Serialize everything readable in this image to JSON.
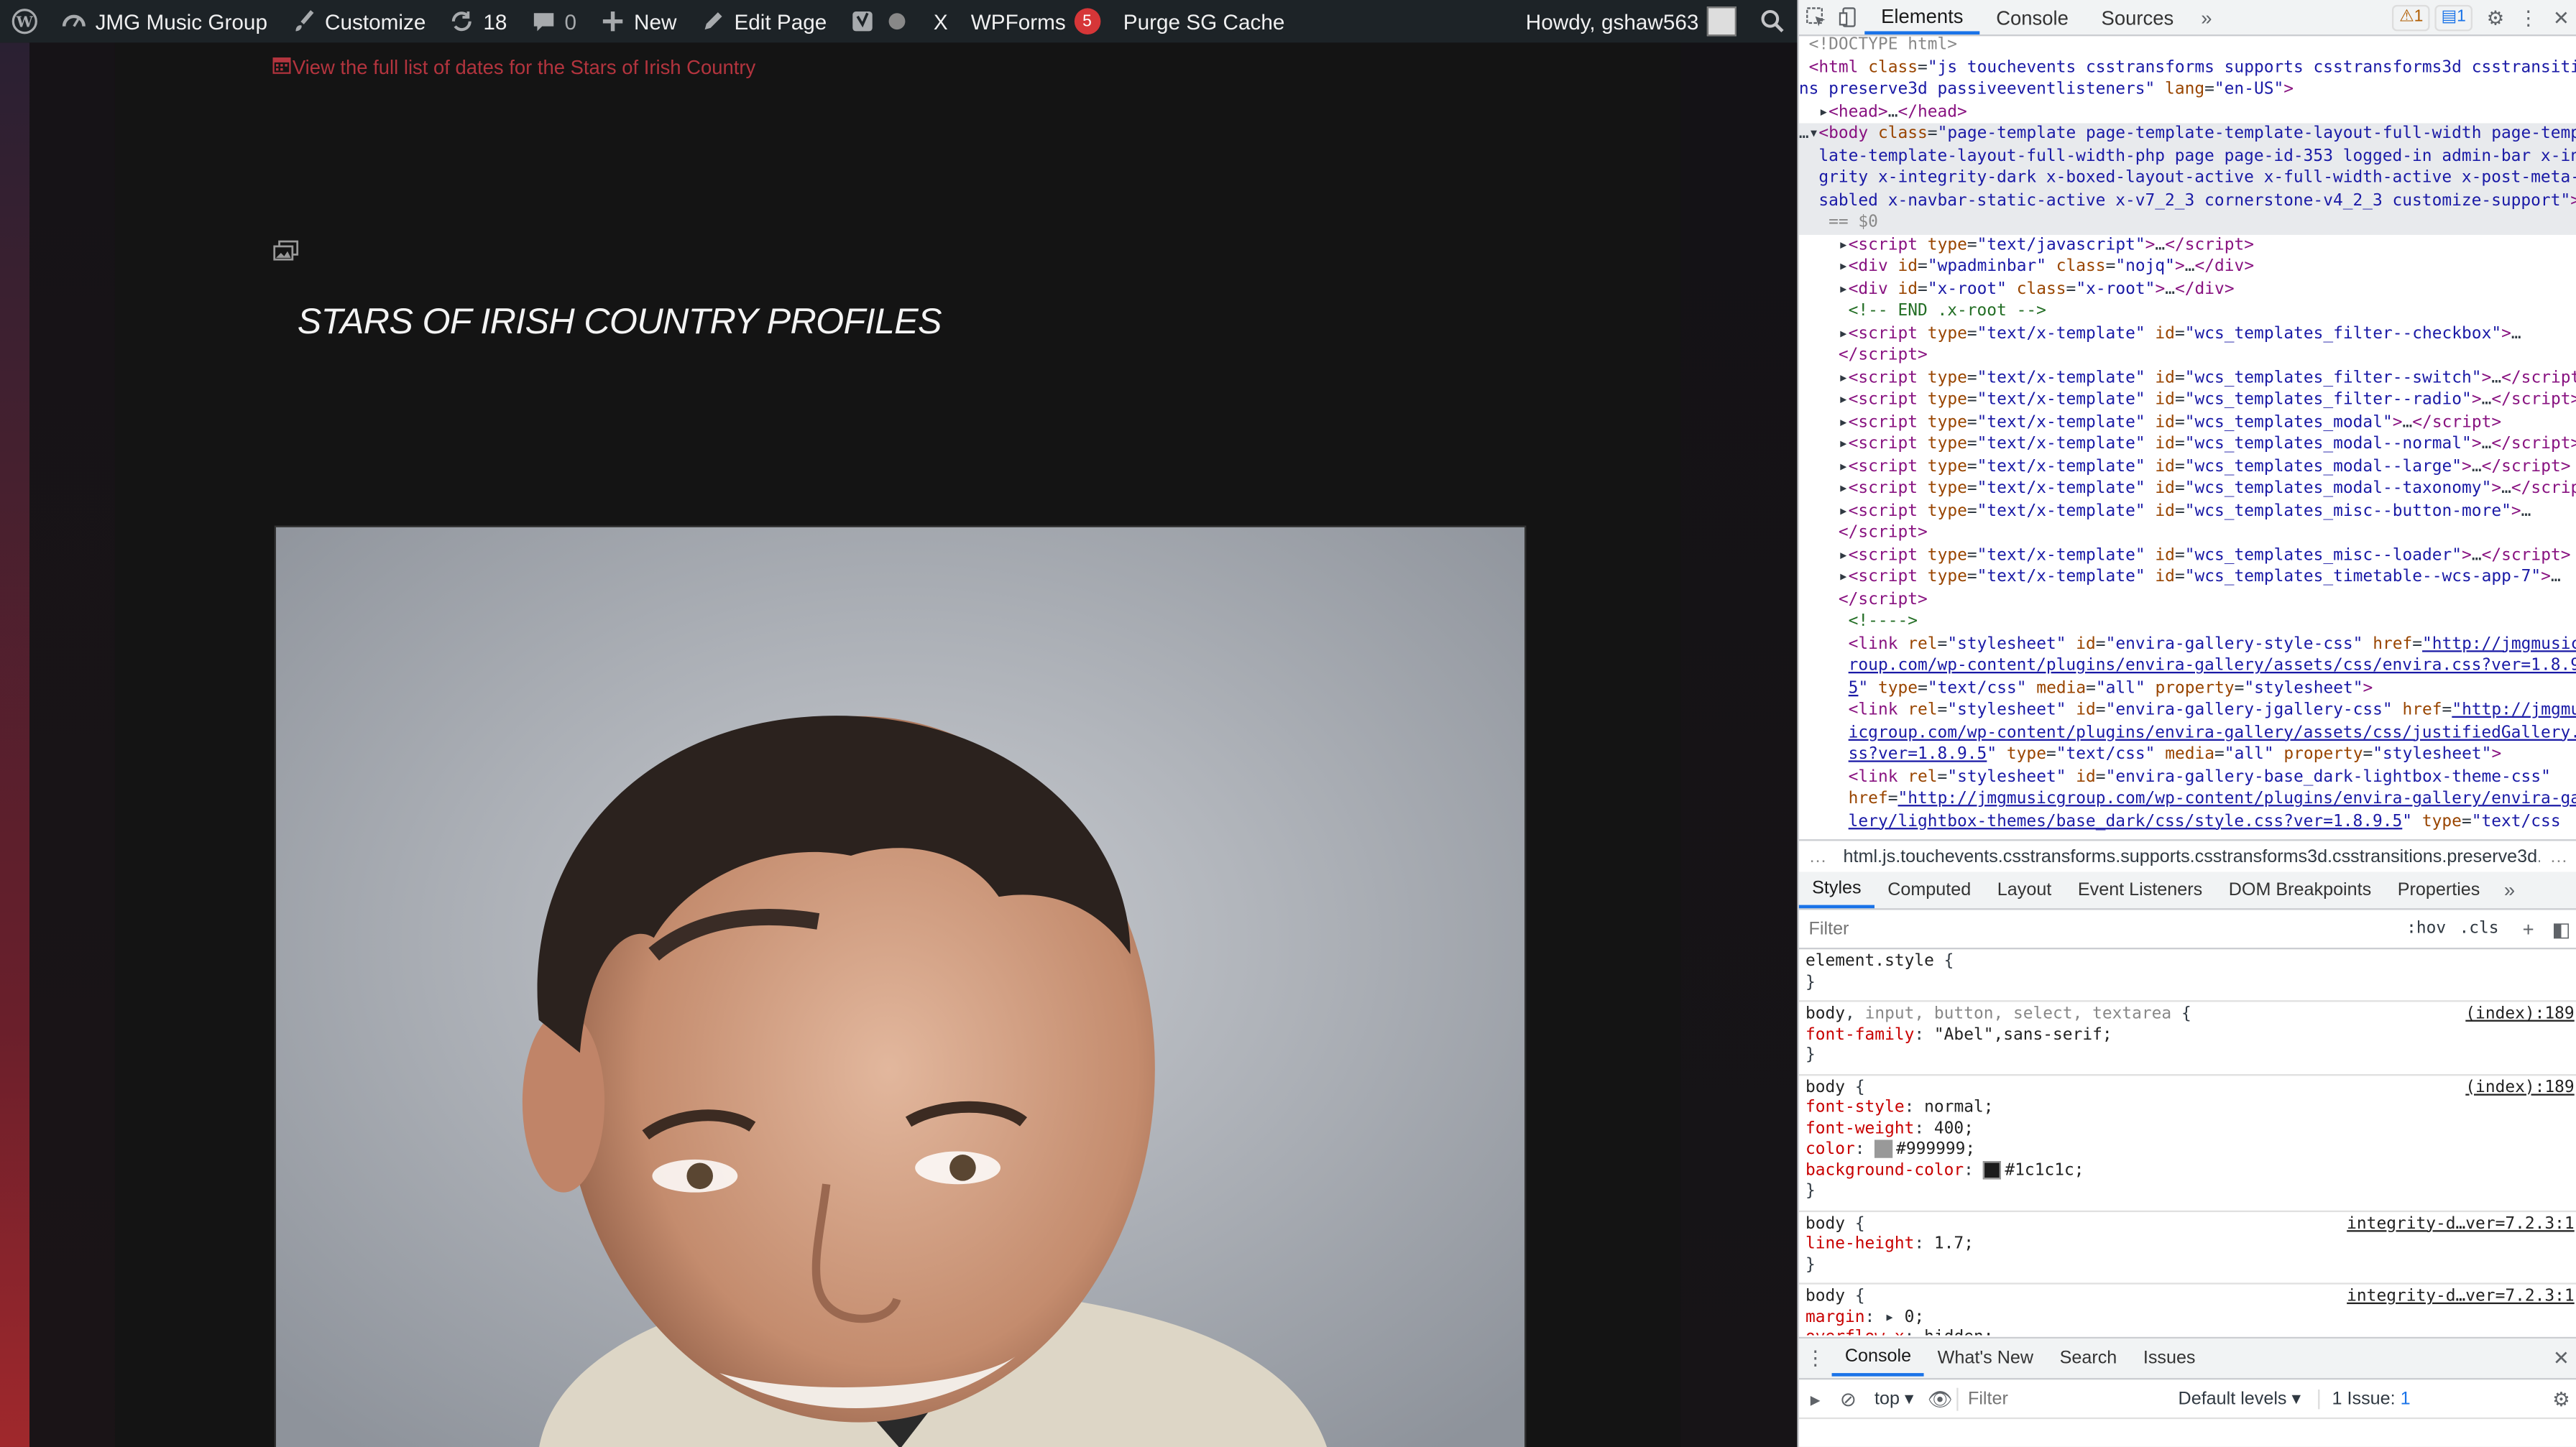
{
  "adminbar": {
    "site_name": "JMG Music Group",
    "customize": "Customize",
    "updates_count": "18",
    "comments_count": "0",
    "new": "New",
    "edit_page": "Edit Page",
    "x_label": "X",
    "wpforms": "WPForms",
    "wpforms_badge": "5",
    "purge": "Purge SG Cache",
    "howdy": "Howdy, gshaw563"
  },
  "page": {
    "dates_link": "View the full list of dates for the Stars of Irish Country",
    "title": "STARS OF IRISH COUNTRY PROFILES"
  },
  "devtools": {
    "tabs": [
      "Elements",
      "Console",
      "Sources"
    ],
    "warn_count": "1",
    "info_count": "1",
    "breadcrumb": "html.js.touchevents.csstransforms.supports.csstransforms3d.csstransitions.preserve3d.p",
    "sub_tabs": [
      "Styles",
      "Computed",
      "Layout",
      "Event Listeners",
      "DOM Breakpoints",
      "Properties"
    ],
    "filter_placeholder": "Filter",
    "hov": ":hov",
    "cls": ".cls",
    "drawer_tabs": [
      "Console",
      "What's New",
      "Search",
      "Issues"
    ],
    "console_context": "top",
    "console_filter_placeholder": "Filter",
    "default_levels": "Default levels",
    "issues_label": "1 Issue:",
    "issues_count": "1"
  }
}
